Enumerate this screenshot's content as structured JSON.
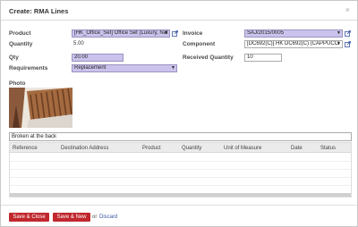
{
  "dialog": {
    "title": "Create: RMA Lines",
    "close_glyph": "×"
  },
  "form": {
    "product": {
      "label": "Product",
      "value": "[HK_Office_Set] Office Set (Luxury, Nat"
    },
    "quantity": {
      "label": "Quantity",
      "value": "5.00"
    },
    "qty": {
      "label": "Qty",
      "value": "20.00"
    },
    "requirements": {
      "label": "Requirements",
      "value": "Replacement"
    },
    "invoice": {
      "label": "Invoice",
      "value": "SAJ/2015/0005"
    },
    "component": {
      "label": "Component",
      "value": "[DC692(C)] HK DC692(C) (CAPPUCCI"
    },
    "received_quantity": {
      "label": "Received Quantity",
      "value": "10"
    },
    "photo_label": "Photo",
    "note_value": "Broken at the back"
  },
  "table": {
    "columns": [
      "Reference",
      "Destination Address",
      "Product",
      "Quantity",
      "Unit of Measure",
      "Date",
      "Status"
    ]
  },
  "footer": {
    "save_close": "Save & Close",
    "save_new": "Save & New",
    "or": "or",
    "discard": "Discard"
  },
  "colors": {
    "required_field": "#cbc3ec",
    "primary_button": "#c0282d",
    "link": "#3a56a5"
  }
}
